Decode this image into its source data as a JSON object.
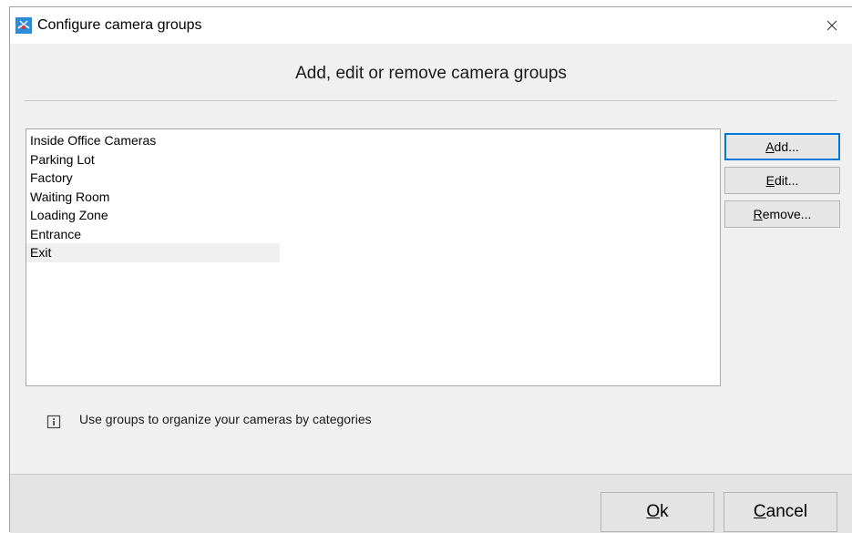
{
  "window": {
    "title": "Configure camera groups",
    "close_glyph": "×"
  },
  "header": {
    "text": "Add, edit or remove camera groups"
  },
  "groups": {
    "items": [
      "Inside Office Cameras",
      "Parking Lot",
      "Factory",
      "Waiting Room",
      "Loading Zone",
      "Entrance",
      "Exit"
    ],
    "selected_index": 6
  },
  "buttons": {
    "add": {
      "mnemonic": "A",
      "rest": "dd..."
    },
    "edit": {
      "mnemonic": "E",
      "rest": "dit..."
    },
    "remove": {
      "mnemonic": "R",
      "rest": "emove..."
    },
    "ok": {
      "mnemonic": "O",
      "rest": "k"
    },
    "cancel": {
      "mnemonic": "C",
      "rest": "ancel"
    }
  },
  "info": {
    "text": "Use groups to organize your cameras by categories"
  },
  "colors": {
    "dialog_bg": "#f0f0f0",
    "footer_bg": "#e4e4e4",
    "default_button_border": "#0078d7",
    "app_icon_blue": "#2a8fd8"
  },
  "icons": {
    "app": "camera-app-icon",
    "close": "close-icon",
    "info": "info-icon"
  }
}
